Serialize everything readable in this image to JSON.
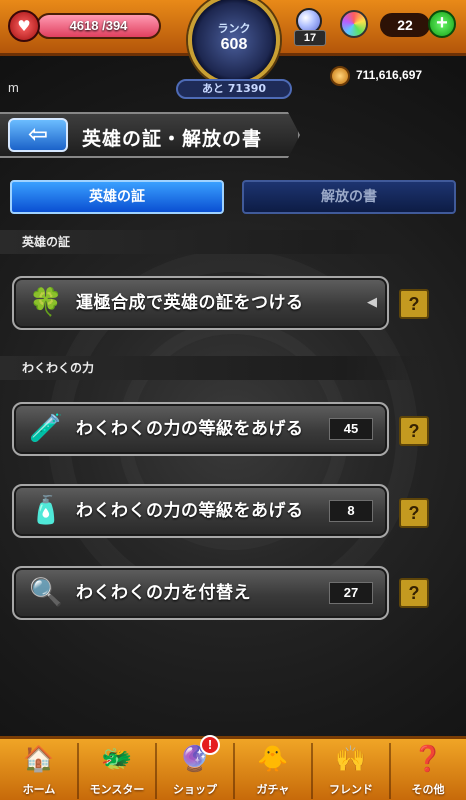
{
  "status": {
    "stamina_current": "4618",
    "stamina_max": "/394",
    "rank_label": "ランク",
    "rank_value": "608",
    "rank_next": "あと 71390",
    "orb_count": "17",
    "gem_count": "22",
    "add_icon": "+",
    "coins": "711,616,697",
    "user_label": "m"
  },
  "header": {
    "back_arrow": "⇦",
    "title": "英雄の証・解放の書"
  },
  "tabs": [
    {
      "label": "英雄の証",
      "active": true
    },
    {
      "label": "解放の書",
      "active": false
    }
  ],
  "sections": [
    {
      "label": "英雄の証"
    },
    {
      "label": "わくわくの力"
    }
  ],
  "actions": [
    {
      "label": "運極合成で英雄の証をつける",
      "icon": "🍀",
      "count": "",
      "arrow": "◀"
    },
    {
      "label": "わくわくの力の等級をあげる",
      "icon": "🧪",
      "count": "45"
    },
    {
      "label": "わくわくの力の等級をあげる",
      "icon": "🧴",
      "count": "8"
    },
    {
      "label": "わくわくの力を付替え",
      "icon": "🔍",
      "count": "27"
    }
  ],
  "help_label": "?",
  "nav": [
    {
      "label": "ホーム",
      "icon": "🏠"
    },
    {
      "label": "モンスター",
      "icon": "🐲"
    },
    {
      "label": "ショップ",
      "icon": "🔮",
      "badge": "!"
    },
    {
      "label": "ガチャ",
      "icon": "🐥"
    },
    {
      "label": "フレンド",
      "icon": "🙌"
    },
    {
      "label": "その他",
      "icon": "❓"
    }
  ]
}
